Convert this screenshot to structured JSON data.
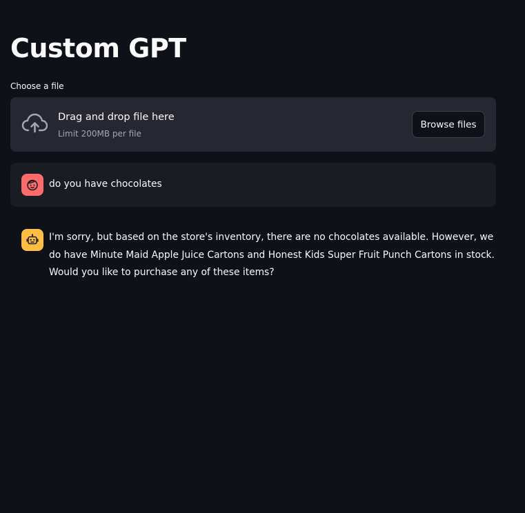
{
  "app": {
    "title": "Custom GPT"
  },
  "uploader": {
    "label": "Choose a file",
    "drop_text": "Drag and drop file here",
    "limit_text": "Limit 200MB per file",
    "browse_label": "Browse files",
    "icon": "cloud-upload-icon"
  },
  "chat": {
    "messages": [
      {
        "role": "user",
        "avatar_icon": "user-face-icon",
        "avatar_color": "#ff6b6b",
        "text": "do you have chocolates"
      },
      {
        "role": "assistant",
        "avatar_icon": "robot-icon",
        "avatar_color": "#ffbd45",
        "text": "I'm sorry, but based on the store's inventory, there are no chocolates available. However, we do have Minute Maid Apple Juice Cartons and Honest Kids Super Fruit Punch Cartons in stock. Would you like to purchase any of these items?"
      }
    ]
  },
  "colors": {
    "background": "#0e1117",
    "dropzone": "#262730",
    "user_bubble": "#1a1c24",
    "text": "#fafafa",
    "muted_text": "#a3a8b8"
  }
}
